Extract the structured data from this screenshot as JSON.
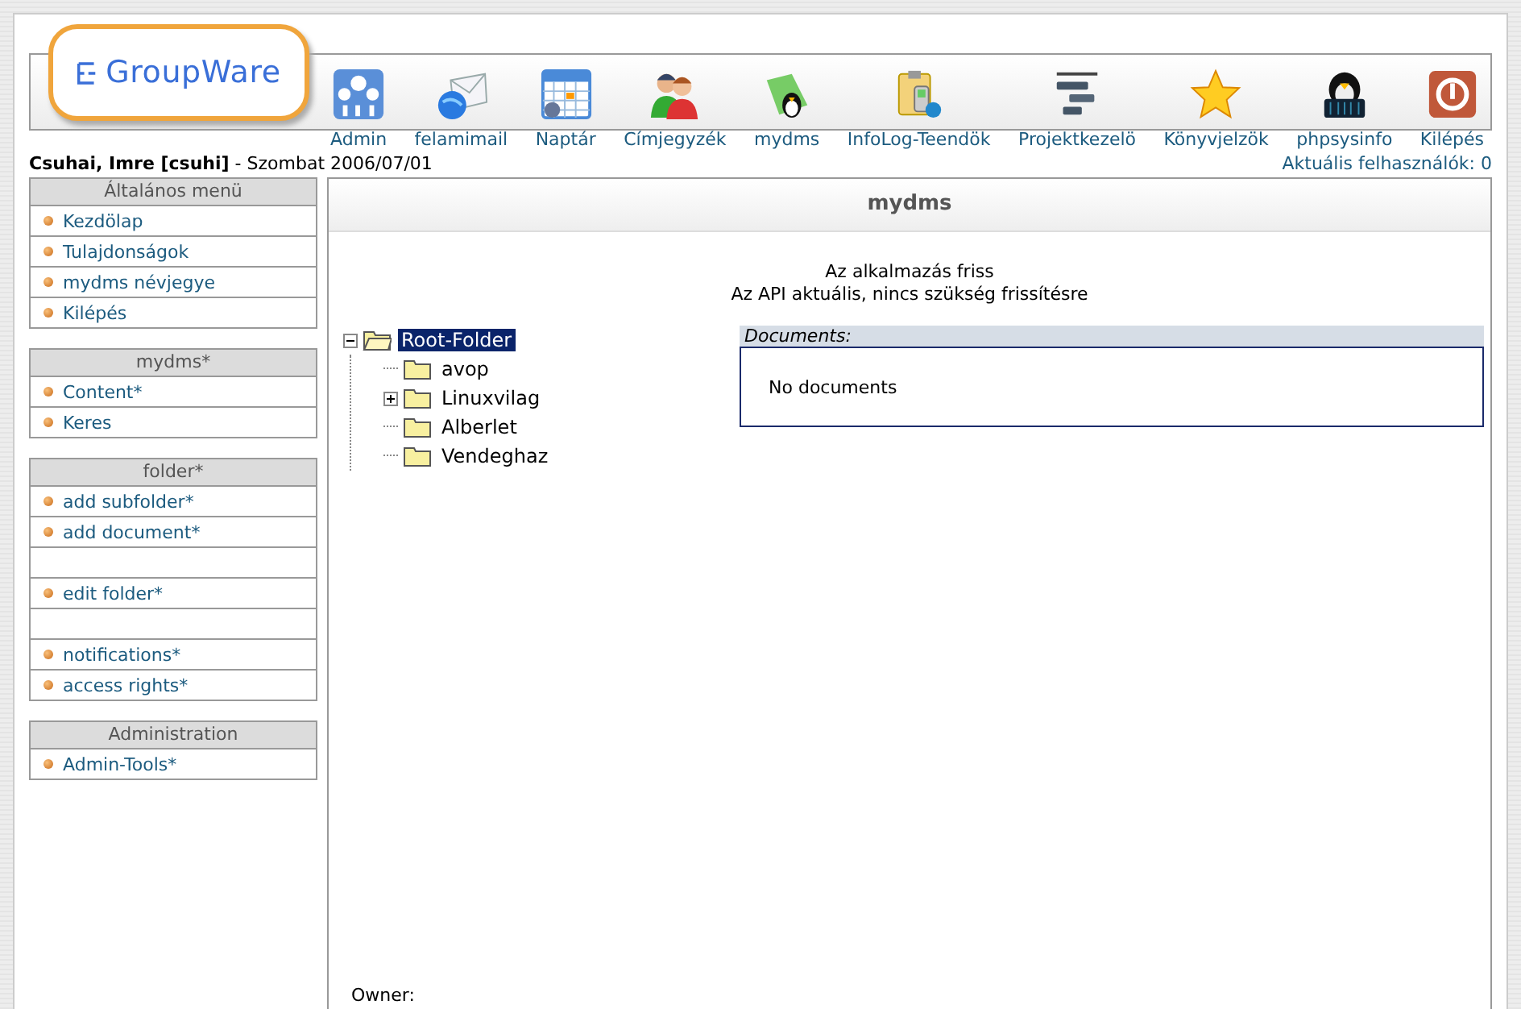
{
  "logo": {
    "text": "GroupWare"
  },
  "apps": [
    {
      "label": "Admin"
    },
    {
      "label": "felamimail"
    },
    {
      "label": "Naptár"
    },
    {
      "label": "Címjegyzék"
    },
    {
      "label": "mydms"
    },
    {
      "label": "InfoLog-Teendök"
    },
    {
      "label": "Projektkezelö"
    },
    {
      "label": "Könyvjelzök"
    },
    {
      "label": "phpsysinfo"
    },
    {
      "label": "Kilépés"
    }
  ],
  "user": {
    "name": "Csuhai, Imre [csuhi]",
    "date": "- Szombat 2006/07/01",
    "online": "Aktuális felhasználók: 0"
  },
  "sidebar": [
    {
      "title": "Általános menü",
      "items": [
        {
          "kind": "link",
          "label": "Kezdölap"
        },
        {
          "kind": "link",
          "label": "Tulajdonságok"
        },
        {
          "kind": "link",
          "label": "mydms névjegye"
        },
        {
          "kind": "link",
          "label": "Kilépés"
        }
      ]
    },
    {
      "title": "mydms*",
      "items": [
        {
          "kind": "link",
          "label": "Content*"
        },
        {
          "kind": "link",
          "label": "Keres"
        }
      ]
    },
    {
      "title": "folder*",
      "items": [
        {
          "kind": "link",
          "label": "add subfolder*"
        },
        {
          "kind": "link",
          "label": "add document*"
        },
        {
          "kind": "blank"
        },
        {
          "kind": "link",
          "label": "edit folder*"
        },
        {
          "kind": "blank"
        },
        {
          "kind": "link",
          "label": "notifications*"
        },
        {
          "kind": "link",
          "label": "access rights*"
        }
      ]
    },
    {
      "title": "Administration",
      "items": [
        {
          "kind": "link",
          "label": "Admin-Tools*"
        }
      ]
    }
  ],
  "main": {
    "title": "mydms",
    "messages": [
      "Az alkalmazás friss",
      "Az API aktuális, nincs szükség frissítésre"
    ],
    "tree": {
      "label": "Root-Folder",
      "selected": true,
      "expanded": true,
      "children": [
        {
          "label": "avop",
          "selected": false
        },
        {
          "label": "Linuxvilag",
          "selected": false,
          "expanded": false
        },
        {
          "label": "Alberlet",
          "selected": false
        },
        {
          "label": "Vendeghaz",
          "selected": false
        }
      ]
    },
    "documents": {
      "title": "Documents:",
      "empty_text": "No documents"
    },
    "owner_label": "Owner:"
  }
}
